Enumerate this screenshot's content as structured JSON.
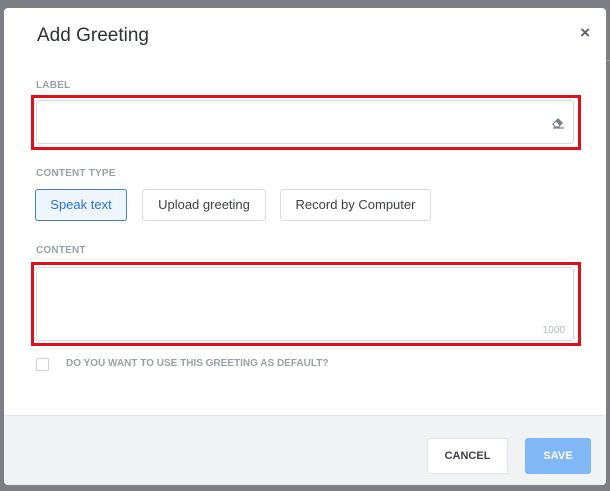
{
  "modal": {
    "title": "Add Greeting",
    "close_glyph": "×"
  },
  "form": {
    "label": {
      "heading": "LABEL",
      "value": "",
      "clear_icon": "eraser-icon"
    },
    "content_type": {
      "heading": "CONTENT TYPE",
      "options": [
        "Speak text",
        "Upload greeting",
        "Record by Computer"
      ],
      "selected": "Speak text"
    },
    "content": {
      "heading": "CONTENT",
      "value": "",
      "max_chars": "1000"
    },
    "default_checkbox": {
      "label": "DO YOU WANT TO USE THIS GREETING AS DEFAULT?",
      "checked": false
    }
  },
  "footer": {
    "cancel_label": "CANCEL",
    "save_label": "SAVE"
  },
  "colors": {
    "highlight": "#e0101a",
    "accent": "#3b82d6",
    "save_button": "#7fb8f5"
  }
}
